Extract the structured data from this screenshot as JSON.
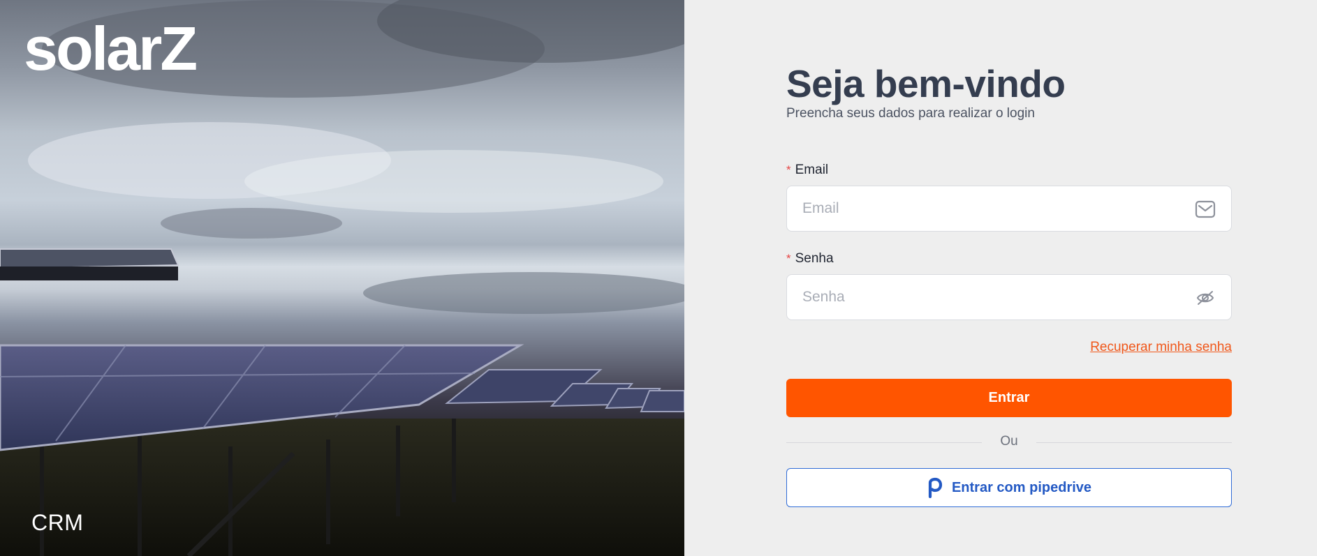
{
  "brand": {
    "logo_text": "solarZ",
    "product_label": "CRM"
  },
  "login": {
    "title": "Seja bem-vindo",
    "subtitle": "Preencha seus dados para realizar o login",
    "email": {
      "required_mark": "*",
      "label": "Email",
      "placeholder": "Email",
      "icon": "mail-icon"
    },
    "password": {
      "required_mark": "*",
      "label": "Senha",
      "placeholder": "Senha",
      "icon": "eye-off-icon"
    },
    "recover_link": "Recuperar minha senha",
    "submit_label": "Entrar",
    "divider_text": "Ou",
    "pipedrive_label": "Entrar com pipedrive",
    "pipedrive_icon": "pipedrive-icon"
  },
  "colors": {
    "primary": "#ff5500",
    "title": "#343d4f",
    "link": "#f0571a",
    "pipedrive": "#2359c4",
    "required": "#e64545",
    "background": "#eeeeee"
  }
}
